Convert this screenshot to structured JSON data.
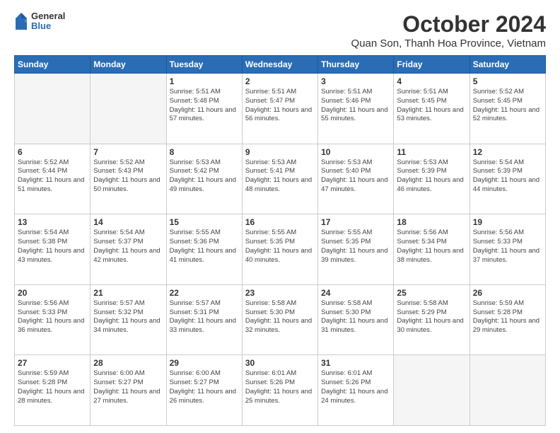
{
  "logo": {
    "general": "General",
    "blue": "Blue"
  },
  "title": "October 2024",
  "subtitle": "Quan Son, Thanh Hoa Province, Vietnam",
  "headers": [
    "Sunday",
    "Monday",
    "Tuesday",
    "Wednesday",
    "Thursday",
    "Friday",
    "Saturday"
  ],
  "weeks": [
    [
      {
        "day": "",
        "sunrise": "",
        "sunset": "",
        "daylight": ""
      },
      {
        "day": "",
        "sunrise": "",
        "sunset": "",
        "daylight": ""
      },
      {
        "day": "1",
        "sunrise": "Sunrise: 5:51 AM",
        "sunset": "Sunset: 5:48 PM",
        "daylight": "Daylight: 11 hours and 57 minutes."
      },
      {
        "day": "2",
        "sunrise": "Sunrise: 5:51 AM",
        "sunset": "Sunset: 5:47 PM",
        "daylight": "Daylight: 11 hours and 56 minutes."
      },
      {
        "day": "3",
        "sunrise": "Sunrise: 5:51 AM",
        "sunset": "Sunset: 5:46 PM",
        "daylight": "Daylight: 11 hours and 55 minutes."
      },
      {
        "day": "4",
        "sunrise": "Sunrise: 5:51 AM",
        "sunset": "Sunset: 5:45 PM",
        "daylight": "Daylight: 11 hours and 53 minutes."
      },
      {
        "day": "5",
        "sunrise": "Sunrise: 5:52 AM",
        "sunset": "Sunset: 5:45 PM",
        "daylight": "Daylight: 11 hours and 52 minutes."
      }
    ],
    [
      {
        "day": "6",
        "sunrise": "Sunrise: 5:52 AM",
        "sunset": "Sunset: 5:44 PM",
        "daylight": "Daylight: 11 hours and 51 minutes."
      },
      {
        "day": "7",
        "sunrise": "Sunrise: 5:52 AM",
        "sunset": "Sunset: 5:43 PM",
        "daylight": "Daylight: 11 hours and 50 minutes."
      },
      {
        "day": "8",
        "sunrise": "Sunrise: 5:53 AM",
        "sunset": "Sunset: 5:42 PM",
        "daylight": "Daylight: 11 hours and 49 minutes."
      },
      {
        "day": "9",
        "sunrise": "Sunrise: 5:53 AM",
        "sunset": "Sunset: 5:41 PM",
        "daylight": "Daylight: 11 hours and 48 minutes."
      },
      {
        "day": "10",
        "sunrise": "Sunrise: 5:53 AM",
        "sunset": "Sunset: 5:40 PM",
        "daylight": "Daylight: 11 hours and 47 minutes."
      },
      {
        "day": "11",
        "sunrise": "Sunrise: 5:53 AM",
        "sunset": "Sunset: 5:39 PM",
        "daylight": "Daylight: 11 hours and 46 minutes."
      },
      {
        "day": "12",
        "sunrise": "Sunrise: 5:54 AM",
        "sunset": "Sunset: 5:39 PM",
        "daylight": "Daylight: 11 hours and 44 minutes."
      }
    ],
    [
      {
        "day": "13",
        "sunrise": "Sunrise: 5:54 AM",
        "sunset": "Sunset: 5:38 PM",
        "daylight": "Daylight: 11 hours and 43 minutes."
      },
      {
        "day": "14",
        "sunrise": "Sunrise: 5:54 AM",
        "sunset": "Sunset: 5:37 PM",
        "daylight": "Daylight: 11 hours and 42 minutes."
      },
      {
        "day": "15",
        "sunrise": "Sunrise: 5:55 AM",
        "sunset": "Sunset: 5:36 PM",
        "daylight": "Daylight: 11 hours and 41 minutes."
      },
      {
        "day": "16",
        "sunrise": "Sunrise: 5:55 AM",
        "sunset": "Sunset: 5:35 PM",
        "daylight": "Daylight: 11 hours and 40 minutes."
      },
      {
        "day": "17",
        "sunrise": "Sunrise: 5:55 AM",
        "sunset": "Sunset: 5:35 PM",
        "daylight": "Daylight: 11 hours and 39 minutes."
      },
      {
        "day": "18",
        "sunrise": "Sunrise: 5:56 AM",
        "sunset": "Sunset: 5:34 PM",
        "daylight": "Daylight: 11 hours and 38 minutes."
      },
      {
        "day": "19",
        "sunrise": "Sunrise: 5:56 AM",
        "sunset": "Sunset: 5:33 PM",
        "daylight": "Daylight: 11 hours and 37 minutes."
      }
    ],
    [
      {
        "day": "20",
        "sunrise": "Sunrise: 5:56 AM",
        "sunset": "Sunset: 5:33 PM",
        "daylight": "Daylight: 11 hours and 36 minutes."
      },
      {
        "day": "21",
        "sunrise": "Sunrise: 5:57 AM",
        "sunset": "Sunset: 5:32 PM",
        "daylight": "Daylight: 11 hours and 34 minutes."
      },
      {
        "day": "22",
        "sunrise": "Sunrise: 5:57 AM",
        "sunset": "Sunset: 5:31 PM",
        "daylight": "Daylight: 11 hours and 33 minutes."
      },
      {
        "day": "23",
        "sunrise": "Sunrise: 5:58 AM",
        "sunset": "Sunset: 5:30 PM",
        "daylight": "Daylight: 11 hours and 32 minutes."
      },
      {
        "day": "24",
        "sunrise": "Sunrise: 5:58 AM",
        "sunset": "Sunset: 5:30 PM",
        "daylight": "Daylight: 11 hours and 31 minutes."
      },
      {
        "day": "25",
        "sunrise": "Sunrise: 5:58 AM",
        "sunset": "Sunset: 5:29 PM",
        "daylight": "Daylight: 11 hours and 30 minutes."
      },
      {
        "day": "26",
        "sunrise": "Sunrise: 5:59 AM",
        "sunset": "Sunset: 5:28 PM",
        "daylight": "Daylight: 11 hours and 29 minutes."
      }
    ],
    [
      {
        "day": "27",
        "sunrise": "Sunrise: 5:59 AM",
        "sunset": "Sunset: 5:28 PM",
        "daylight": "Daylight: 11 hours and 28 minutes."
      },
      {
        "day": "28",
        "sunrise": "Sunrise: 6:00 AM",
        "sunset": "Sunset: 5:27 PM",
        "daylight": "Daylight: 11 hours and 27 minutes."
      },
      {
        "day": "29",
        "sunrise": "Sunrise: 6:00 AM",
        "sunset": "Sunset: 5:27 PM",
        "daylight": "Daylight: 11 hours and 26 minutes."
      },
      {
        "day": "30",
        "sunrise": "Sunrise: 6:01 AM",
        "sunset": "Sunset: 5:26 PM",
        "daylight": "Daylight: 11 hours and 25 minutes."
      },
      {
        "day": "31",
        "sunrise": "Sunrise: 6:01 AM",
        "sunset": "Sunset: 5:26 PM",
        "daylight": "Daylight: 11 hours and 24 minutes."
      },
      {
        "day": "",
        "sunrise": "",
        "sunset": "",
        "daylight": ""
      },
      {
        "day": "",
        "sunrise": "",
        "sunset": "",
        "daylight": ""
      }
    ]
  ]
}
